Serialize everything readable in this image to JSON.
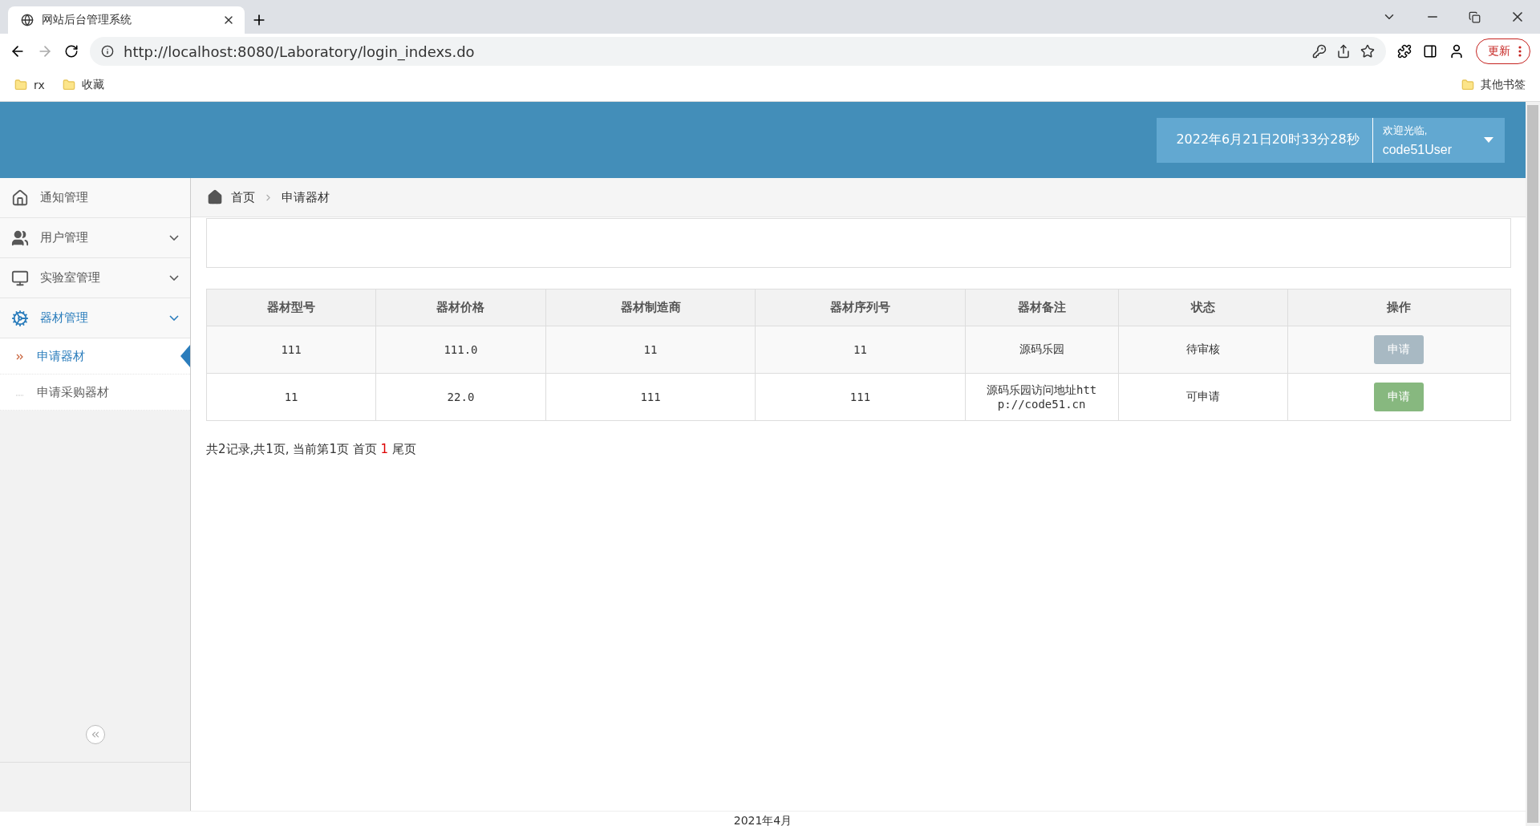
{
  "browser": {
    "tab_title": "网站后台管理系统",
    "url": "http://localhost:8080/Laboratory/login_indexs.do",
    "update_label": "更新",
    "bookmarks": [
      "rx",
      "收藏"
    ],
    "other_bookmarks": "其他书签"
  },
  "header": {
    "datetime": "2022年6月21日20时33分28秒",
    "welcome": "欢迎光临,",
    "user": "code51User"
  },
  "sidebar": {
    "items": [
      {
        "label": "通知管理",
        "expandable": false,
        "active": false
      },
      {
        "label": "用户管理",
        "expandable": true,
        "active": false
      },
      {
        "label": "实验室管理",
        "expandable": true,
        "active": false
      },
      {
        "label": "器材管理",
        "expandable": true,
        "active": true,
        "children": [
          {
            "label": "申请器材",
            "selected": true
          },
          {
            "label": "申请采购器材",
            "selected": false
          }
        ]
      }
    ]
  },
  "breadcrumb": [
    "首页",
    "申请器材"
  ],
  "table": {
    "columns": [
      "器材型号",
      "器材价格",
      "器材制造商",
      "器材序列号",
      "器材备注",
      "状态",
      "操作"
    ],
    "rows": [
      {
        "cells": [
          "111",
          "111.0",
          "11",
          "11",
          "源码乐园",
          "待审核"
        ],
        "action": "申请",
        "disabled": true
      },
      {
        "cells": [
          "11",
          "22.0",
          "111",
          "111",
          "源码乐园访问地址http://code51.cn",
          "可申请"
        ],
        "action": "申请",
        "disabled": false
      }
    ]
  },
  "pagination": {
    "summary": "共2记录,共1页, 当前第1页 首页",
    "current": "1",
    "last": "尾页"
  },
  "footer": "2021年4月"
}
